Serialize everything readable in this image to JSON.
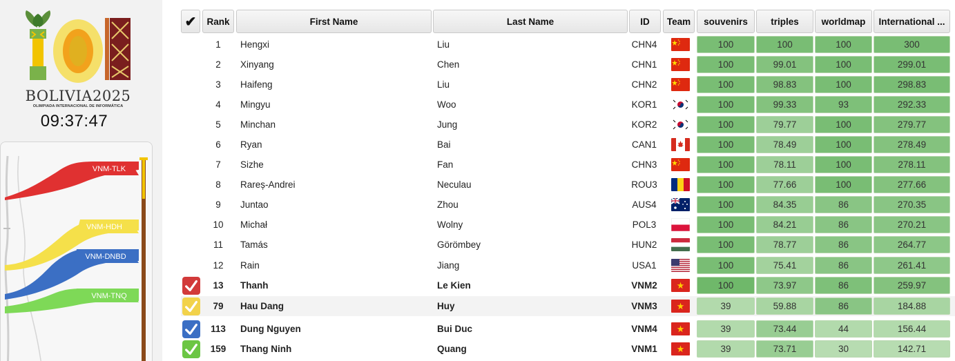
{
  "app": {
    "logo_title": "BOLIVIA2025",
    "logo_caption": "OLIMPIADA INTERNACIONAL DE INFORMÁTICA",
    "clock": "09:37:47"
  },
  "race": {
    "flags": [
      {
        "label": "VNM-TLK",
        "color": "#e03131"
      },
      {
        "label": "VNM-HDH",
        "color": "#f5e04a"
      },
      {
        "label": "VNM-DNBD",
        "color": "#3b6fc4"
      },
      {
        "label": "VNM-TNQ",
        "color": "#7ed957"
      }
    ]
  },
  "table": {
    "headers": {
      "check": "✔",
      "rank": "Rank",
      "first": "First Name",
      "last": "Last Name",
      "id": "ID",
      "team": "Team",
      "tasks": [
        "souvenirs",
        "triples",
        "worldmap",
        "International ..."
      ]
    },
    "rows": [
      {
        "rank": "1",
        "first": "Hengxi",
        "last": "Liu",
        "id": "CHN4",
        "flag": "cn",
        "scores": [
          "100",
          "100",
          "100",
          "300"
        ],
        "shade": [
          0.9,
          0.9,
          0.9,
          0.9
        ]
      },
      {
        "rank": "2",
        "first": "Xinyang",
        "last": "Chen",
        "id": "CHN1",
        "flag": "cn",
        "scores": [
          "100",
          "99.01",
          "100",
          "299.01"
        ],
        "shade": [
          0.9,
          0.8,
          0.9,
          0.9
        ]
      },
      {
        "rank": "3",
        "first": "Haifeng",
        "last": "Liu",
        "id": "CHN2",
        "flag": "cn",
        "scores": [
          "100",
          "98.83",
          "100",
          "298.83"
        ],
        "shade": [
          0.9,
          0.8,
          0.9,
          0.9
        ]
      },
      {
        "rank": "4",
        "first": "Mingyu",
        "last": "Woo",
        "id": "KOR1",
        "flag": "kr",
        "scores": [
          "100",
          "99.33",
          "93",
          "292.33"
        ],
        "shade": [
          0.9,
          0.8,
          0.85,
          0.85
        ]
      },
      {
        "rank": "5",
        "first": "Minchan",
        "last": "Jung",
        "id": "KOR2",
        "flag": "kr",
        "scores": [
          "100",
          "79.77",
          "100",
          "279.77"
        ],
        "shade": [
          0.9,
          0.55,
          0.9,
          0.8
        ]
      },
      {
        "rank": "6",
        "first": "Ryan",
        "last": "Bai",
        "id": "CAN1",
        "flag": "ca",
        "scores": [
          "100",
          "78.49",
          "100",
          "278.49"
        ],
        "shade": [
          0.9,
          0.55,
          0.9,
          0.8
        ]
      },
      {
        "rank": "7",
        "first": "Sizhe",
        "last": "Fan",
        "id": "CHN3",
        "flag": "cn",
        "scores": [
          "100",
          "78.11",
          "100",
          "278.11"
        ],
        "shade": [
          0.9,
          0.55,
          0.9,
          0.8
        ]
      },
      {
        "rank": "8",
        "first": "Rareș-Andrei",
        "last": "Neculau",
        "id": "ROU3",
        "flag": "ro",
        "scores": [
          "100",
          "77.66",
          "100",
          "277.66"
        ],
        "shade": [
          0.9,
          0.55,
          0.9,
          0.8
        ]
      },
      {
        "rank": "9",
        "first": "Juntao",
        "last": "Zhou",
        "id": "AUS4",
        "flag": "au",
        "scores": [
          "100",
          "84.35",
          "86",
          "270.35"
        ],
        "shade": [
          0.9,
          0.6,
          0.75,
          0.75
        ]
      },
      {
        "rank": "10",
        "first": "Michał",
        "last": "Wolny",
        "id": "POL3",
        "flag": "pl",
        "scores": [
          "100",
          "84.21",
          "86",
          "270.21"
        ],
        "shade": [
          0.9,
          0.6,
          0.75,
          0.75
        ]
      },
      {
        "rank": "11",
        "first": "Tamás",
        "last": "Görömbey",
        "id": "HUN2",
        "flag": "hu",
        "scores": [
          "100",
          "78.77",
          "86",
          "264.77"
        ],
        "shade": [
          0.9,
          0.55,
          0.75,
          0.72
        ]
      },
      {
        "rank": "12",
        "first": "Rain",
        "last": "Jiang",
        "id": "USA1",
        "flag": "us",
        "scores": [
          "100",
          "75.41",
          "86",
          "261.41"
        ],
        "shade": [
          0.9,
          0.5,
          0.75,
          0.7
        ]
      },
      {
        "rank": "13",
        "first": "Thanh",
        "last": "Le Kien",
        "id": "VNM2",
        "flag": "vn",
        "scores": [
          "100",
          "73.97",
          "86",
          "259.97"
        ],
        "shade": [
          1.0,
          0.7,
          0.85,
          0.8
        ],
        "check": "#d23a3a"
      },
      {
        "rank": "79",
        "first": "Hau Dang",
        "last": "Huy",
        "id": "VNM3",
        "flag": "vn",
        "scores": [
          "39",
          "59.88",
          "86",
          "184.88"
        ],
        "shade": [
          0.35,
          0.45,
          0.75,
          0.45
        ],
        "check": "#f2d24a"
      },
      {
        "rank": "113",
        "first": "Dung Nguyen",
        "last": "Bui Duc",
        "id": "VNM4",
        "flag": "vn",
        "scores": [
          "39",
          "73.44",
          "44",
          "156.44"
        ],
        "shade": [
          0.35,
          0.6,
          0.35,
          0.35
        ],
        "check": "#3b6fc4"
      },
      {
        "rank": "159",
        "first": "Thang Ninh",
        "last": "Quang",
        "id": "VNM1",
        "flag": "vn",
        "scores": [
          "39",
          "73.71",
          "30",
          "142.71"
        ],
        "shade": [
          0.35,
          0.6,
          0.3,
          0.3
        ],
        "check": "#6cc644"
      }
    ]
  }
}
